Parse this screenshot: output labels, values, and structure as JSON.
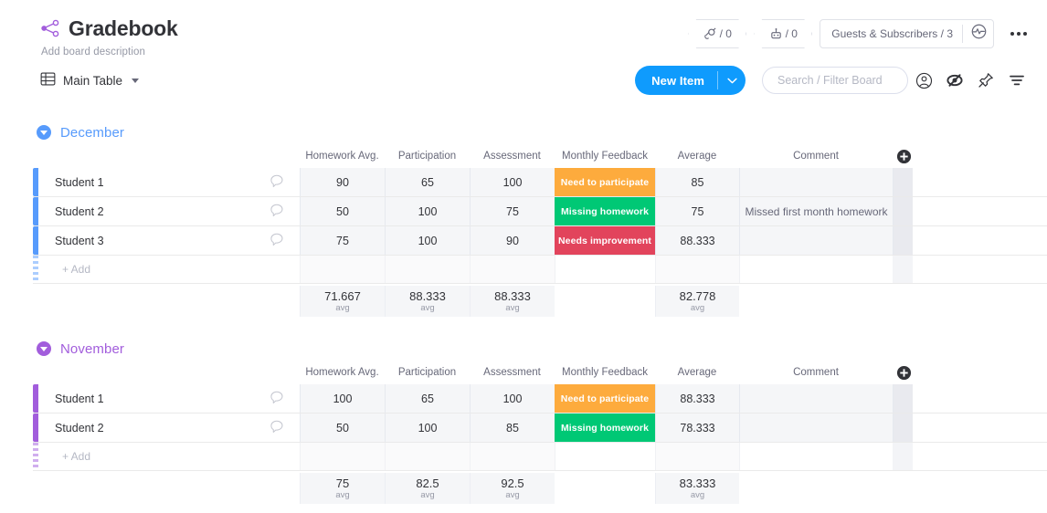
{
  "header": {
    "share_icon": "share-icon",
    "title": "Gradebook",
    "description": "Add board description",
    "updates_count": "/ 0",
    "automations_count": "/ 0",
    "guests_label": "Guests & Subscribers / 3",
    "activity_icon": "activity-icon",
    "more_icon": "more-options-icon"
  },
  "toolbar": {
    "view_name": "Main Table",
    "new_item_label": "New Item",
    "search_placeholder": "Search / Filter Board",
    "search_value": "",
    "person_icon": "person-filter-icon",
    "hide_icon": "hide-columns-icon",
    "pin_icon": "pin-icon",
    "filter_icon": "filter-icon"
  },
  "columns": [
    "Homework Avg.",
    "Participation",
    "Assessment",
    "Monthly Feedback",
    "Average",
    "Comment"
  ],
  "add_column_icon": "add-column-icon",
  "add_row_label": "+ Add",
  "summary_unit": "avg",
  "status_colors": {
    "need_to_participate": "#fdab3d",
    "missing_homework": "#00c875",
    "needs_improvement": "#e2445c"
  },
  "groups": [
    {
      "name": "December",
      "color": "#579bfc",
      "rows": [
        {
          "name": "Student 1",
          "homework": "90",
          "participation": "65",
          "assessment": "100",
          "feedback": "Need to participate",
          "feedback_color": "#fdab3d",
          "average": "85",
          "comment": ""
        },
        {
          "name": "Student 2",
          "homework": "50",
          "participation": "100",
          "assessment": "75",
          "feedback": "Missing homework",
          "feedback_color": "#00c875",
          "average": "75",
          "comment": "Missed first month homework"
        },
        {
          "name": "Student 3",
          "homework": "75",
          "participation": "100",
          "assessment": "90",
          "feedback": "Needs improvement",
          "feedback_color": "#e2445c",
          "average": "88.333",
          "comment": ""
        }
      ],
      "summary": {
        "homework": "71.667",
        "participation": "88.333",
        "assessment": "88.333",
        "feedback": "",
        "average": "82.778",
        "comment": ""
      }
    },
    {
      "name": "November",
      "color": "#a25ddc",
      "rows": [
        {
          "name": "Student 1",
          "homework": "100",
          "participation": "65",
          "assessment": "100",
          "feedback": "Need to participate",
          "feedback_color": "#fdab3d",
          "average": "88.333",
          "comment": ""
        },
        {
          "name": "Student 2",
          "homework": "50",
          "participation": "100",
          "assessment": "85",
          "feedback": "Missing homework",
          "feedback_color": "#00c875",
          "average": "78.333",
          "comment": ""
        }
      ],
      "summary": {
        "homework": "75",
        "participation": "82.5",
        "assessment": "92.5",
        "feedback": "",
        "average": "83.333",
        "comment": ""
      }
    }
  ]
}
